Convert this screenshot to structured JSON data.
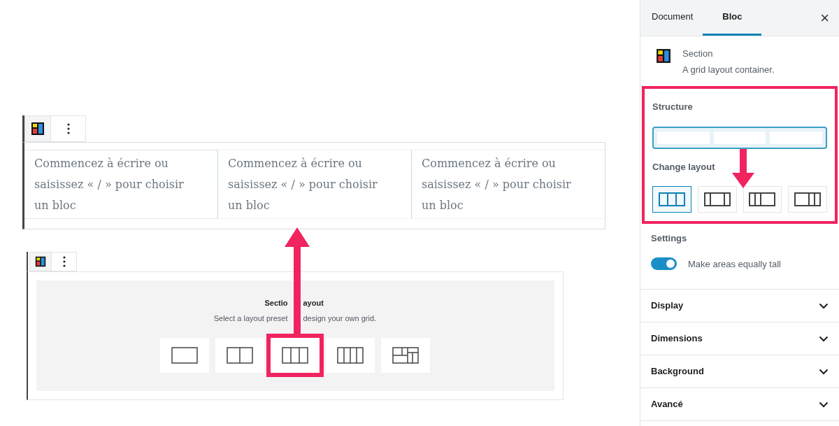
{
  "editor": {
    "section_block": {
      "columns": [
        {
          "placeholder": "Commencez à écrire ou saisissez « / » pour choisir un bloc"
        },
        {
          "placeholder": "Commencez à écrire ou saisissez « / » pour choisir un bloc"
        },
        {
          "placeholder": "Commencez à écrire ou saisissez « / » pour choisir un bloc"
        }
      ]
    },
    "layout_picker": {
      "title_left": "Sectio",
      "title_right": "ayout",
      "subtitle_left": "Select a layout preset",
      "subtitle_right": "design your own grid.",
      "presets": [
        {
          "kind": "one",
          "selected": false
        },
        {
          "kind": "two",
          "selected": false
        },
        {
          "kind": "three",
          "selected": true
        },
        {
          "kind": "four",
          "selected": false
        },
        {
          "kind": "grid",
          "selected": false
        }
      ]
    }
  },
  "sidebar": {
    "tabs": [
      {
        "label": "Document",
        "selected": false
      },
      {
        "label": "Bloc",
        "selected": true
      }
    ],
    "close": "×",
    "block": {
      "name": "Section",
      "description": "A grid layout container."
    },
    "structure": {
      "label": "Structure"
    },
    "change_layout": {
      "label": "Change layout",
      "options": [
        {
          "kind": "equal",
          "selected": true
        },
        {
          "kind": "wide_middle",
          "selected": false
        },
        {
          "kind": "wide_right",
          "selected": false
        },
        {
          "kind": "wide_left",
          "selected": false
        }
      ]
    },
    "settings": {
      "label": "Settings",
      "toggle": {
        "label": "Make areas equally tall",
        "on": true
      }
    },
    "panels": [
      {
        "label": "Display",
        "expanded": false
      },
      {
        "label": "Dimensions",
        "expanded": false
      },
      {
        "label": "Background",
        "expanded": false
      },
      {
        "label": "Avancé",
        "expanded": false
      }
    ]
  }
}
